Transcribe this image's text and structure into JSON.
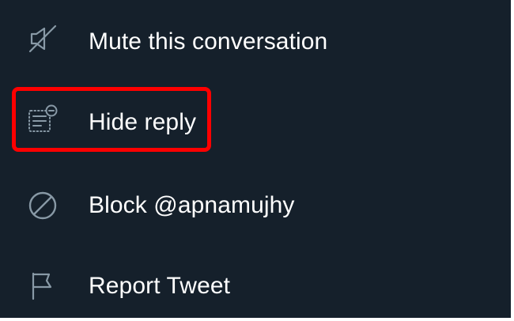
{
  "menu": {
    "items": [
      {
        "label": "Mute this conversation",
        "icon": "mute-icon"
      },
      {
        "label": "Hide reply",
        "icon": "hide-reply-icon"
      },
      {
        "label": "Block @apnamujhy",
        "icon": "block-icon"
      },
      {
        "label": "Report Tweet",
        "icon": "flag-icon"
      }
    ]
  },
  "colors": {
    "background": "#15202b",
    "text": "#ffffff",
    "icon": "#8899a6",
    "highlight": "#ff0000"
  }
}
